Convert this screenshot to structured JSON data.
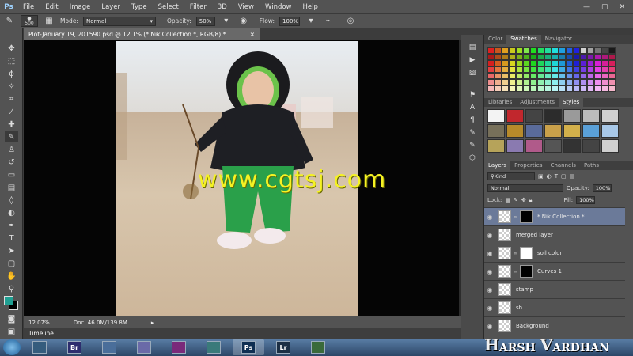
{
  "app": {
    "logo": "Ps"
  },
  "menu": [
    "File",
    "Edit",
    "Image",
    "Layer",
    "Type",
    "Select",
    "Filter",
    "3D",
    "View",
    "Window",
    "Help"
  ],
  "window_controls": {
    "minimize": "—",
    "maximize": "▢",
    "close": "✕"
  },
  "options_bar": {
    "brush_size": "500",
    "mode_label": "Mode:",
    "mode_value": "Normal",
    "opacity_label": "Opacity:",
    "opacity_value": "50%",
    "flow_label": "Flow:",
    "flow_value": "100%"
  },
  "document": {
    "tab_title": "Plot-January 19, 201590.psd @ 12.1% (* Nik Collection *, RGB/8) *",
    "tab_close": "×",
    "watermark": "www.cgtsj.com"
  },
  "status": {
    "zoom": "12.07%",
    "doc_size": "Doc: 46.0M/139.8M"
  },
  "timeline": {
    "label": "Timeline"
  },
  "panels": {
    "top_tabs": [
      "Color",
      "Swatches",
      "Navigator"
    ],
    "top_active": 1,
    "mid_tabs": [
      "Libraries",
      "Adjustments",
      "Styles"
    ],
    "mid_active": 2,
    "layer_tabs": [
      "Layers",
      "Properties",
      "Channels",
      "Paths"
    ],
    "layer_active": 0
  },
  "layers": {
    "filter_kind": "Kind",
    "blend_mode": "Normal",
    "opacity_label": "Opacity:",
    "opacity_value": "100%",
    "lock_label": "Lock:",
    "fill_label": "Fill:",
    "fill_value": "100%",
    "items": [
      {
        "name": "* Nik Collection *",
        "selected": true,
        "mask": "black"
      },
      {
        "name": "merged layer",
        "selected": false,
        "mask": "none"
      },
      {
        "name": "soil color",
        "selected": false,
        "mask": "white"
      },
      {
        "name": "Curves 1",
        "selected": false,
        "mask": "black"
      },
      {
        "name": "stamp",
        "selected": false,
        "mask": "none"
      },
      {
        "name": "sh",
        "selected": false,
        "mask": "none"
      },
      {
        "name": "Background",
        "selected": false,
        "mask": "none"
      }
    ]
  },
  "taskbar": {
    "apps": [
      "",
      "Br",
      "",
      "",
      "",
      "",
      "Ps",
      "Lr",
      ""
    ],
    "active_index": 6
  },
  "brand": {
    "text1": "ARSH",
    "text2": "ARDHAN",
    "h": "H",
    "v": "V"
  },
  "colors": {
    "foreground": "#1f9f92",
    "background": "#000000",
    "accent": "#6b7a99"
  }
}
